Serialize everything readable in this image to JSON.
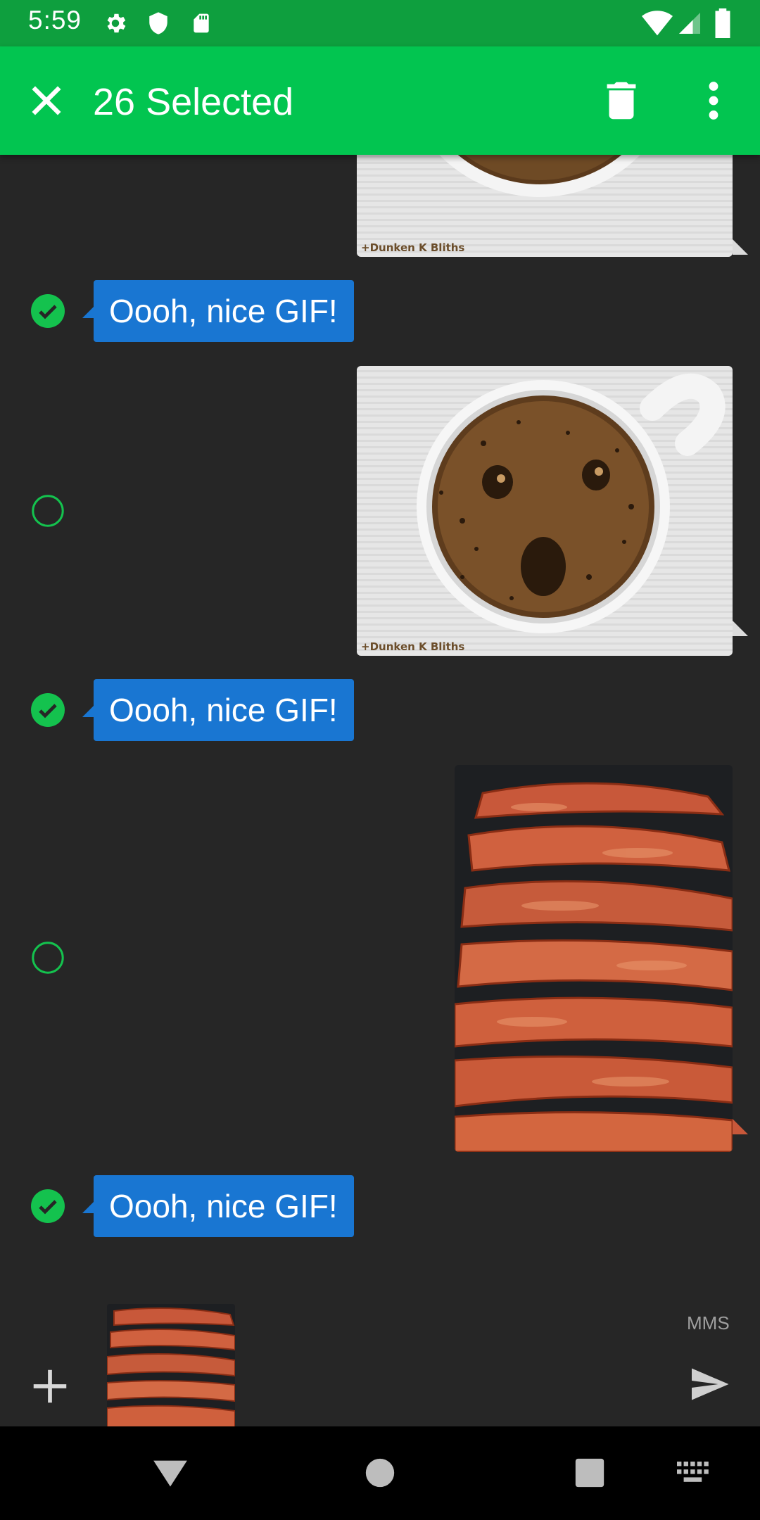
{
  "status_bar": {
    "time": "5:59",
    "icons": [
      "settings-icon",
      "shield-icon",
      "sd-card-icon",
      "wifi-icon",
      "cell-signal-icon",
      "battery-icon"
    ]
  },
  "app_bar": {
    "title": "26 Selected",
    "close_icon": "close-icon",
    "delete_icon": "delete-icon",
    "more_icon": "more-vert-icon",
    "color": "#02c550"
  },
  "messages": [
    {
      "type": "image",
      "image": "coffee-face",
      "watermark": "+Dunken K Bliths",
      "selected": null
    },
    {
      "type": "text",
      "text": "Oooh, nice GIF!",
      "selected": true
    },
    {
      "type": "image",
      "image": "coffee-face",
      "watermark": "+Dunken K Bliths",
      "selected": false
    },
    {
      "type": "text",
      "text": "Oooh, nice GIF!",
      "selected": true
    },
    {
      "type": "image",
      "image": "bacon",
      "selected": false
    },
    {
      "type": "text",
      "text": "Oooh, nice GIF!",
      "selected": true
    }
  ],
  "composer": {
    "attachment": "bacon",
    "mms_label": "MMS",
    "add_icon": "add-icon",
    "send_icon": "send-icon"
  },
  "nav_bar": {
    "icons": [
      "back-icon",
      "home-icon",
      "recents-icon",
      "keyboard-icon"
    ]
  },
  "colors": {
    "accent": "#02c550",
    "status_bar": "#0e9f3e",
    "bubble": "#1976d2",
    "background": "#262626",
    "check": "#14c24e"
  }
}
